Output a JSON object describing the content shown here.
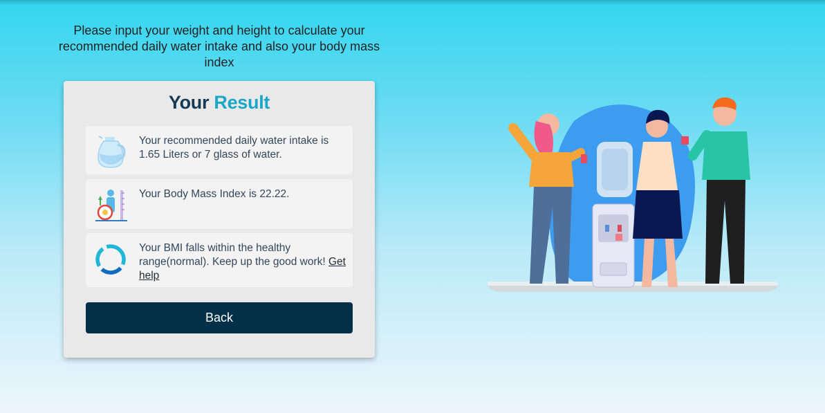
{
  "intro": {
    "text": "Please input your weight and height to calculate your recommended daily water intake and also your body mass index"
  },
  "result": {
    "title_part1": "Your",
    "title_part2": "Result",
    "water_text": "Your recommended daily water intake is 1.65 Liters or 7 glass of water.",
    "bmi_text": "Your Body Mass Index is 22.22.",
    "range_text": "Your BMI falls within the healthy range(normal). Keep up the good work!",
    "help_link": "Get help",
    "back_label": "Back"
  },
  "colors": {
    "title_dark": "#163a55",
    "title_accent": "#1aa6c6",
    "button": "#033049",
    "background_top": "#33d6ef"
  },
  "icons": [
    "water-jug-icon",
    "bmi-measure-icon",
    "ring-chart-icon",
    "water-cooler-illustration"
  ]
}
